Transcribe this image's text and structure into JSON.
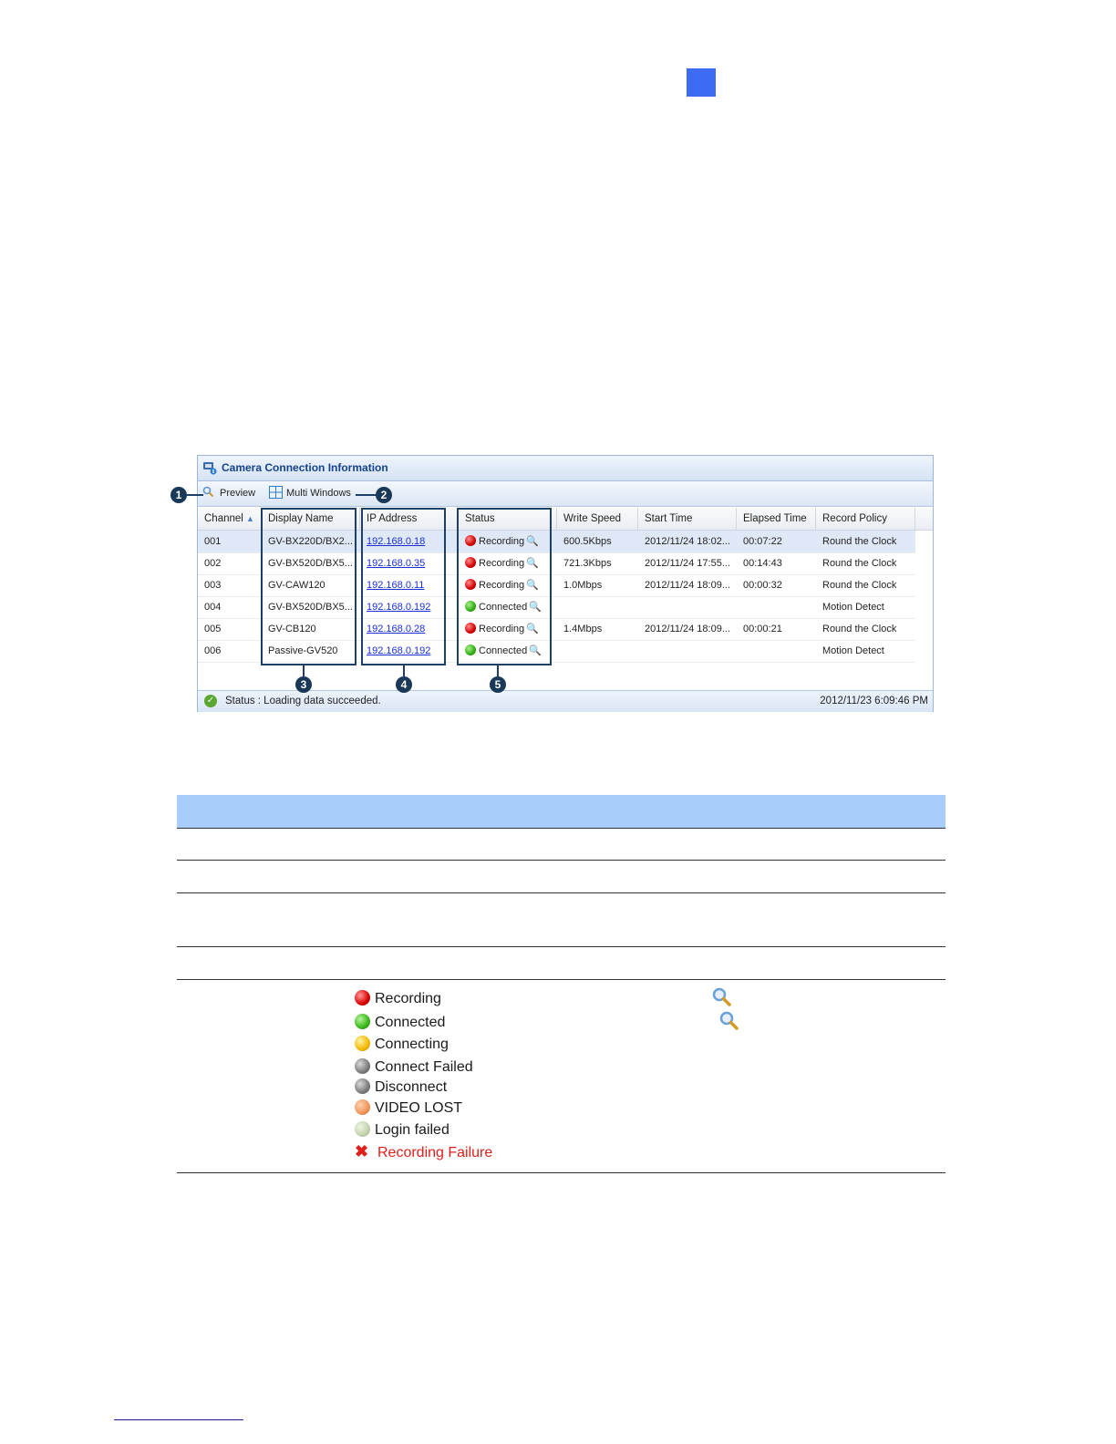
{
  "panel": {
    "title": "Camera Connection Information",
    "toolbar": {
      "preview": "Preview",
      "multi_windows": "Multi Windows"
    },
    "columns": [
      "Channel",
      "Display Name",
      "IP Address",
      "Status",
      "Write Speed",
      "Start Time",
      "Elapsed Time",
      "Record Policy"
    ],
    "rows": [
      {
        "channel": "001",
        "name": "GV-BX220D/BX2...",
        "ip": "192.168.0.18",
        "status": "Recording",
        "status_color": "red",
        "speed": "600.5Kbps",
        "start": "2012/11/24 18:02...",
        "elapsed": "00:07:22",
        "policy": "Round the Clock"
      },
      {
        "channel": "002",
        "name": "GV-BX520D/BX5...",
        "ip": "192.168.0.35",
        "status": "Recording",
        "status_color": "red",
        "speed": "721.3Kbps",
        "start": "2012/11/24 17:55...",
        "elapsed": "00:14:43",
        "policy": "Round the Clock"
      },
      {
        "channel": "003",
        "name": "GV-CAW120",
        "ip": "192.168.0.11",
        "status": "Recording",
        "status_color": "red",
        "speed": "1.0Mbps",
        "start": "2012/11/24 18:09...",
        "elapsed": "00:00:32",
        "policy": "Round the Clock"
      },
      {
        "channel": "004",
        "name": "GV-BX520D/BX5...",
        "ip": "192.168.0.192",
        "status": "Connected",
        "status_color": "green",
        "speed": "",
        "start": "",
        "elapsed": "",
        "policy": "Motion Detect"
      },
      {
        "channel": "005",
        "name": "GV-CB120",
        "ip": "192.168.0.28",
        "status": "Recording",
        "status_color": "red",
        "speed": "1.4Mbps",
        "start": "2012/11/24 18:09...",
        "elapsed": "00:00:21",
        "policy": "Round the Clock"
      },
      {
        "channel": "006",
        "name": "Passive-GV520",
        "ip": "192.168.0.192",
        "status": "Connected",
        "status_color": "green",
        "speed": "",
        "start": "",
        "elapsed": "",
        "policy": "Motion Detect"
      }
    ],
    "status_bar": {
      "text": "Status : Loading data succeeded.",
      "time": "2012/11/23 6:09:46 PM"
    },
    "callouts": [
      "1",
      "2",
      "3",
      "4",
      "5"
    ]
  },
  "legend": [
    {
      "label": "Recording",
      "color": "red"
    },
    {
      "label": "Connected",
      "color": "green"
    },
    {
      "label": "Connecting",
      "color": "yellow"
    },
    {
      "label": "Connect Failed",
      "color": "gray"
    },
    {
      "label": "Disconnect",
      "color": "gray"
    },
    {
      "label": "VIDEO LOST",
      "color": "orange"
    },
    {
      "label": "Login failed",
      "color": "pale"
    },
    {
      "label": "Recording Failure",
      "color": "x-red"
    }
  ],
  "colors": {
    "accent_blue": "#3d6bf2",
    "table_header": "#a9cdfb",
    "failure_red": "#e0201c"
  }
}
